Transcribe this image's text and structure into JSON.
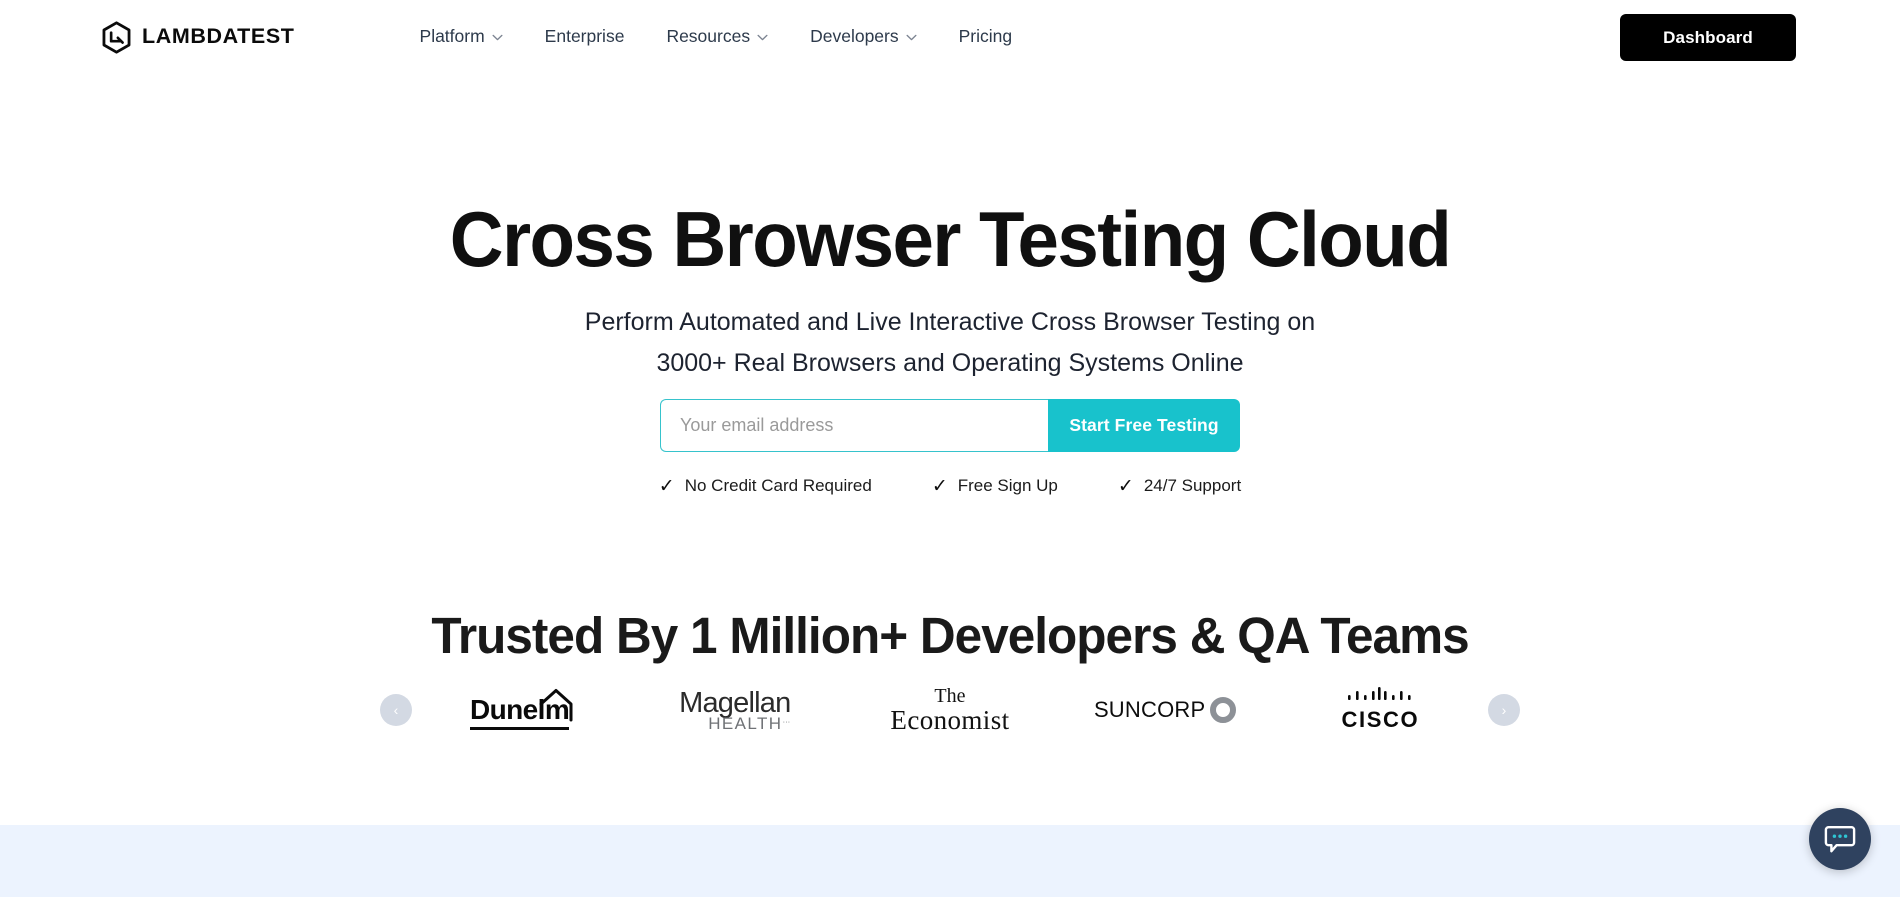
{
  "header": {
    "brand": {
      "name": "LAMBDATEST",
      "logo_icon": "lambdatest-hex-logo"
    },
    "nav": [
      {
        "label": "Platform",
        "has_dropdown": true
      },
      {
        "label": "Enterprise",
        "has_dropdown": false
      },
      {
        "label": "Resources",
        "has_dropdown": true
      },
      {
        "label": "Developers",
        "has_dropdown": true
      },
      {
        "label": "Pricing",
        "has_dropdown": false
      }
    ],
    "dashboard_label": "Dashboard"
  },
  "hero": {
    "title": "Cross Browser Testing Cloud",
    "subtitle_line1": "Perform Automated and Live Interactive Cross Browser Testing on",
    "subtitle_line2": "3000+ Real Browsers and Operating Systems Online",
    "form": {
      "email_placeholder": "Your email address",
      "email_value": "",
      "cta_label": "Start Free Testing"
    },
    "features": [
      {
        "tick": "✓",
        "label": "No Credit Card Required"
      },
      {
        "tick": "✓",
        "label": "Free Sign Up"
      },
      {
        "tick": "✓",
        "label": "24/7 Support"
      }
    ]
  },
  "trusted": {
    "title": "Trusted By 1 Million+ Developers & QA Teams",
    "prev_arrow": "‹",
    "next_arrow": "›",
    "logos": [
      {
        "name": "Dunelm",
        "word": "Dunelm"
      },
      {
        "name": "Magellan Health",
        "word": "Magellan",
        "sub": "HEALTH",
        "tm": "…"
      },
      {
        "name": "The Economist",
        "line1": "The",
        "line2": "Economist"
      },
      {
        "name": "Suncorp",
        "word": "SUNCORP"
      },
      {
        "name": "Cisco",
        "word": "CISCO"
      }
    ]
  },
  "chat": {
    "icon": "chat-bubble-icon"
  },
  "colors": {
    "accent_teal": "#18c2cc",
    "dashboard_black": "#000000",
    "band_blue": "#ecf3fe",
    "chat_navy": "#2f425f",
    "arrow_grey": "#d3d9e3"
  }
}
